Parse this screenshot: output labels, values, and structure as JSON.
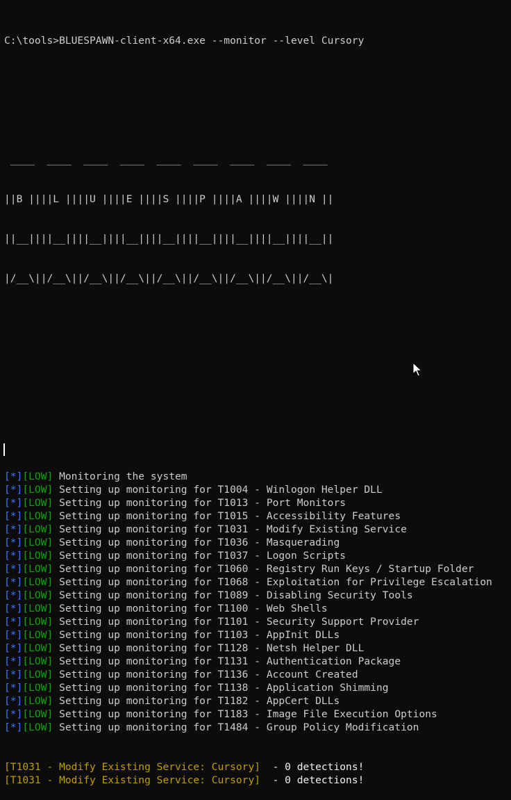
{
  "command": "C:\\tools>BLUESPAWN-client-x64.exe --monitor --level Cursory",
  "banner": [
    " ____  ____  ____  ____  ____  ____  ____  ____  ____",
    "||B ||||L ||||U ||||E ||||S ||||P ||||A ||||W ||||N ||",
    "||__||||__||||__||||__||||__||||__||||__||||__||||__||",
    "|/__\\||/__\\||/__\\||/__\\||/__\\||/__\\||/__\\||/__\\||/__\\|"
  ],
  "log": [
    {
      "star": "[*]",
      "level": "[LOW]",
      "message": " Monitoring the system"
    },
    {
      "star": "[*]",
      "level": "[LOW]",
      "message": " Setting up monitoring for T1004 - Winlogon Helper DLL"
    },
    {
      "star": "[*]",
      "level": "[LOW]",
      "message": " Setting up monitoring for T1013 - Port Monitors"
    },
    {
      "star": "[*]",
      "level": "[LOW]",
      "message": " Setting up monitoring for T1015 - Accessibility Features"
    },
    {
      "star": "[*]",
      "level": "[LOW]",
      "message": " Setting up monitoring for T1031 - Modify Existing Service"
    },
    {
      "star": "[*]",
      "level": "[LOW]",
      "message": " Setting up monitoring for T1036 - Masquerading"
    },
    {
      "star": "[*]",
      "level": "[LOW]",
      "message": " Setting up monitoring for T1037 - Logon Scripts"
    },
    {
      "star": "[*]",
      "level": "[LOW]",
      "message": " Setting up monitoring for T1060 - Registry Run Keys / Startup Folder"
    },
    {
      "star": "[*]",
      "level": "[LOW]",
      "message": " Setting up monitoring for T1068 - Exploitation for Privilege Escalation"
    },
    {
      "star": "[*]",
      "level": "[LOW]",
      "message": " Setting up monitoring for T1089 - Disabling Security Tools"
    },
    {
      "star": "[*]",
      "level": "[LOW]",
      "message": " Setting up monitoring for T1100 - Web Shells"
    },
    {
      "star": "[*]",
      "level": "[LOW]",
      "message": " Setting up monitoring for T1101 - Security Support Provider"
    },
    {
      "star": "[*]",
      "level": "[LOW]",
      "message": " Setting up monitoring for T1103 - AppInit DLLs"
    },
    {
      "star": "[*]",
      "level": "[LOW]",
      "message": " Setting up monitoring for T1128 - Netsh Helper DLL"
    },
    {
      "star": "[*]",
      "level": "[LOW]",
      "message": " Setting up monitoring for T1131 - Authentication Package"
    },
    {
      "star": "[*]",
      "level": "[LOW]",
      "message": " Setting up monitoring for T1136 - Account Created"
    },
    {
      "star": "[*]",
      "level": "[LOW]",
      "message": " Setting up monitoring for T1138 - Application Shimming"
    },
    {
      "star": "[*]",
      "level": "[LOW]",
      "message": " Setting up monitoring for T1182 - AppCert DLLs"
    },
    {
      "star": "[*]",
      "level": "[LOW]",
      "message": " Setting up monitoring for T1183 - Image File Execution Options"
    },
    {
      "star": "[*]",
      "level": "[LOW]",
      "message": " Setting up monitoring for T1484 - Group Policy Modification"
    }
  ],
  "detections": [
    {
      "tag": "[T1031 - Modify Existing Service: Cursory]",
      "result": "  - 0 detections!"
    },
    {
      "tag": "[T1031 - Modify Existing Service: Cursory]",
      "result": "  - 0 detections!"
    }
  ],
  "colors": {
    "background": "#0c0c0c",
    "text": "#cccccc",
    "star_tag": "#3b78ff",
    "low_tag": "#13a10e",
    "detection_tag": "#c19c00"
  },
  "icons": {
    "cursor": "text-cursor",
    "pointer": "mouse-pointer-icon"
  }
}
